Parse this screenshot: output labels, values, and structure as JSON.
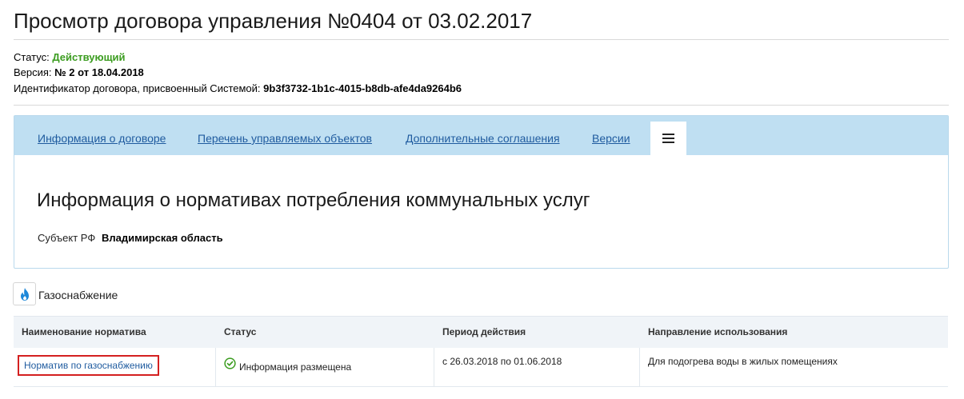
{
  "header": {
    "title": "Просмотр договора управления №0404 от 03.02.2017"
  },
  "meta": {
    "status_label": "Статус:",
    "status_value": "Действующий",
    "version_label": "Версия:",
    "version_value": "№ 2 от 18.04.2018",
    "id_label": "Идентификатор договора, присвоенный Системой:",
    "id_value": "9b3f3732-1b1c-4015-b8db-afe4da9264b6"
  },
  "tabs": [
    {
      "label": "Информация о договоре"
    },
    {
      "label": "Перечень управляемых объектов"
    },
    {
      "label": "Дополнительные соглашения"
    },
    {
      "label": "Версии"
    }
  ],
  "tab_active_icon": "menu-icon",
  "section": {
    "title": "Информация о нормативах потребления коммунальных услуг",
    "subject_label": "Субъект РФ",
    "subject_value": "Владимирская область"
  },
  "resource": {
    "icon": "flame-icon",
    "label": "Газоснабжение"
  },
  "table": {
    "headers": [
      "Наименование норматива",
      "Статус",
      "Период действия",
      "Направление использования"
    ],
    "rows": [
      {
        "name": "Норматив по газоснабжению",
        "status": "Информация размещена",
        "period": "с 26.03.2018 по 01.06.2018",
        "direction": "Для подогрева воды в жилых помещениях"
      }
    ]
  },
  "colors": {
    "accent_link": "#1f5b9f",
    "status_active": "#3b9c1f",
    "tabbar_bg": "#bfdff2",
    "highlight_border": "#d42020"
  }
}
